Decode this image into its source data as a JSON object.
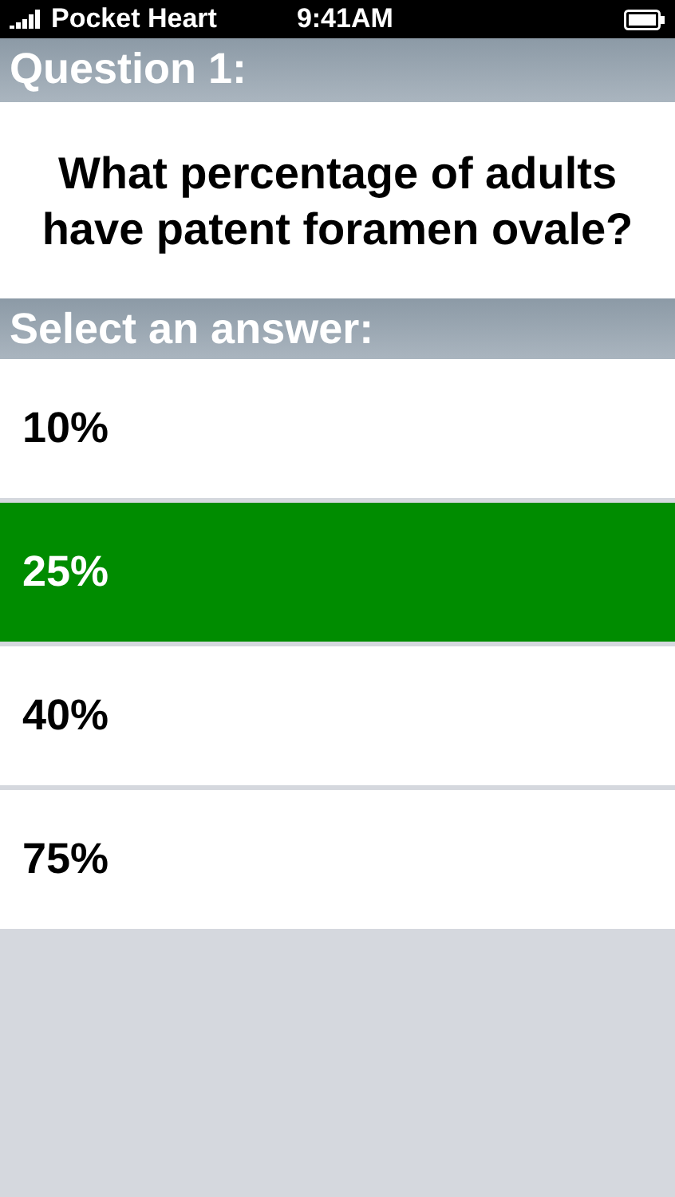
{
  "status_bar": {
    "carrier": "Pocket Heart",
    "time": "9:41AM"
  },
  "question": {
    "heading": "Question 1:",
    "text": "What percentage of adults have patent foramen ovale?"
  },
  "answers_heading": "Select an answer:",
  "answers": [
    {
      "label": "10%",
      "selected": false
    },
    {
      "label": "25%",
      "selected": true
    },
    {
      "label": "40%",
      "selected": false
    },
    {
      "label": "75%",
      "selected": false
    }
  ]
}
